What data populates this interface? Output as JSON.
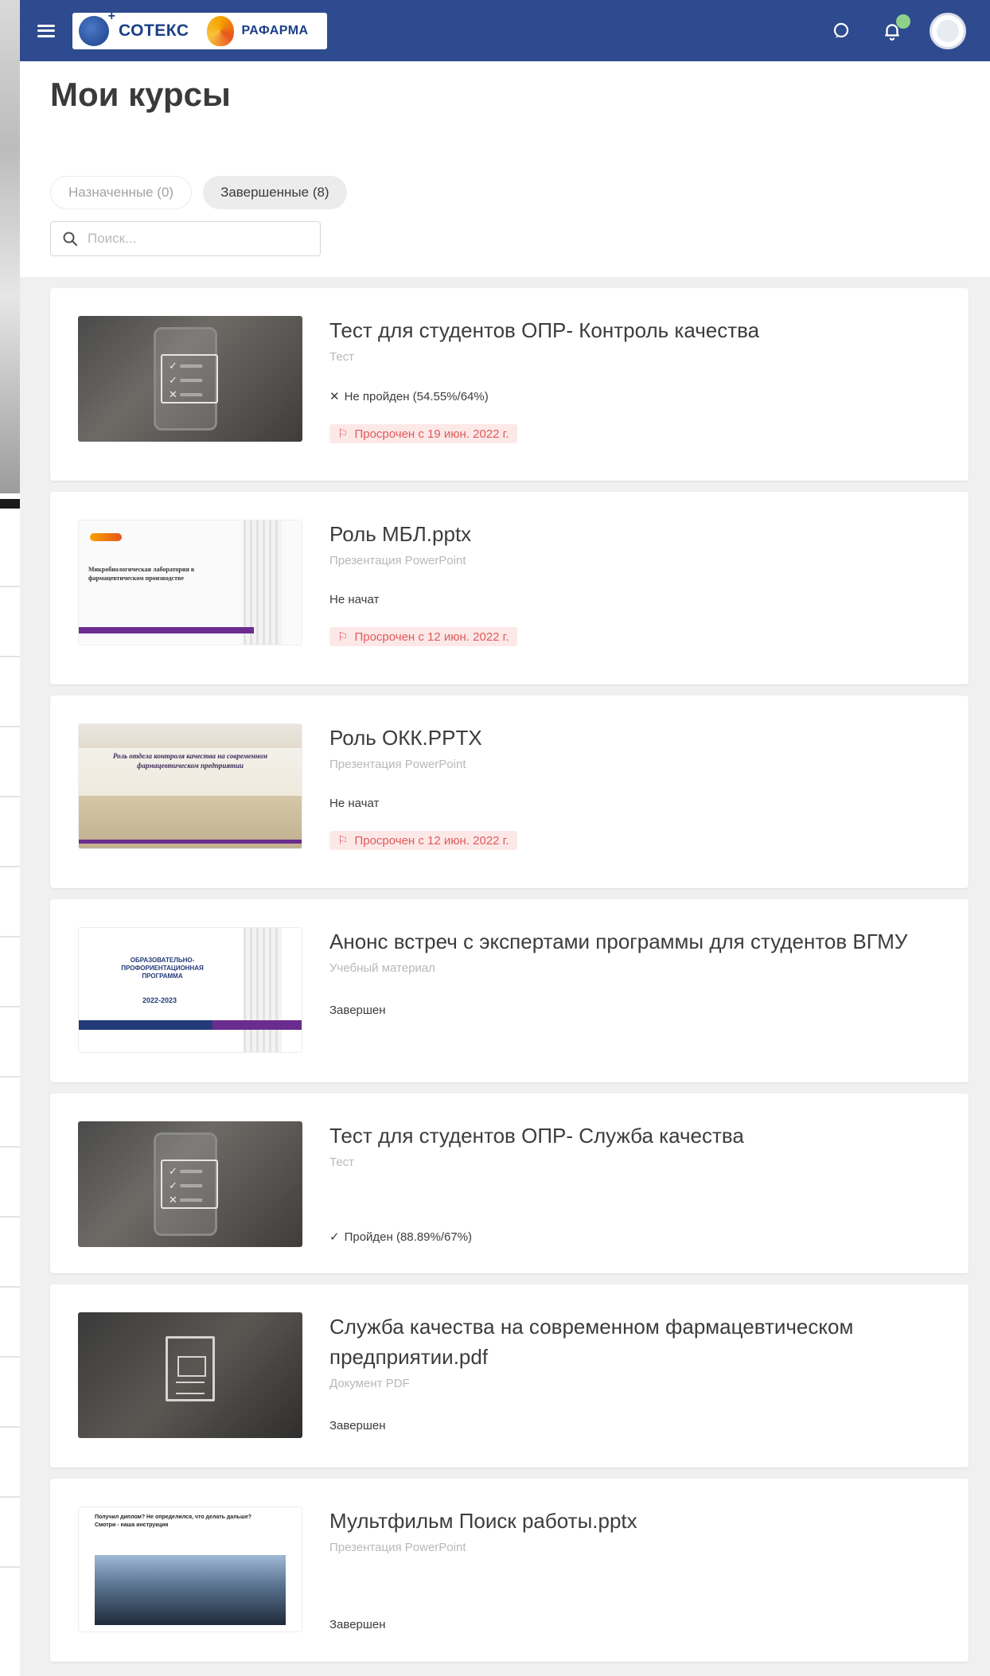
{
  "header": {
    "logo_text_1": "СОТЕКС",
    "logo_text_2": "РАФАРМА",
    "notification_count": "",
    "bar_color": "#2e4b8f"
  },
  "page": {
    "title": "Мои курсы"
  },
  "tabs": [
    {
      "label": "Назначенные (0)",
      "active": false
    },
    {
      "label": "Завершенные (8)",
      "active": true
    }
  ],
  "search": {
    "placeholder": "Поиск..."
  },
  "courses": [
    {
      "title": "Тест для студентов ОПР- Контроль качества",
      "type": "Тест",
      "status_icon": "cross-icon",
      "status": "Не пройден (54.55%/64%)",
      "overdue": "Просрочен с 19 июн. 2022 г."
    },
    {
      "title": "Роль МБЛ.pptx",
      "type": "Презентация PowerPoint",
      "status": "Не начат",
      "overdue": "Просрочен с 12 июн. 2022 г."
    },
    {
      "title": "Роль ОКК.PPTX",
      "type": "Презентация PowerPoint",
      "status": "Не начат",
      "overdue": "Просрочен с 12 июн. 2022 г."
    },
    {
      "title": "Анонс встреч с экспертами программы для студентов ВГМУ",
      "type": "Учебный материал",
      "status": "Завершен"
    },
    {
      "title": "Тест для студентов ОПР- Служба качества",
      "type": "Тест",
      "status_icon": "check-icon",
      "status": "Пройден (88.89%/67%)"
    },
    {
      "title": "Служба качества на современном фармацевтическом предприятии.pdf",
      "type": "Документ PDF",
      "status": "Завершен"
    },
    {
      "title": "Мультфильм Поиск работы.pptx",
      "type": "Презентация PowerPoint",
      "status": "Завершен"
    }
  ],
  "thumbnails": {
    "slide_mbl": "Микробиологическая лаборатория в фармацевтическом производстве",
    "slide_okk": "Роль отдела контроля качества на современном фармацевтическом предприятии",
    "slide_program": "ОБРАЗОВАТЕЛЬНО-ПРОФОРИЕНТАЦИОННАЯ ПРОГРАММА",
    "slide_program_year": "2022-2023",
    "slide_cartoon": "Получил диплом? Не определился, что делать дальше? Смотри - наша инструкция"
  }
}
